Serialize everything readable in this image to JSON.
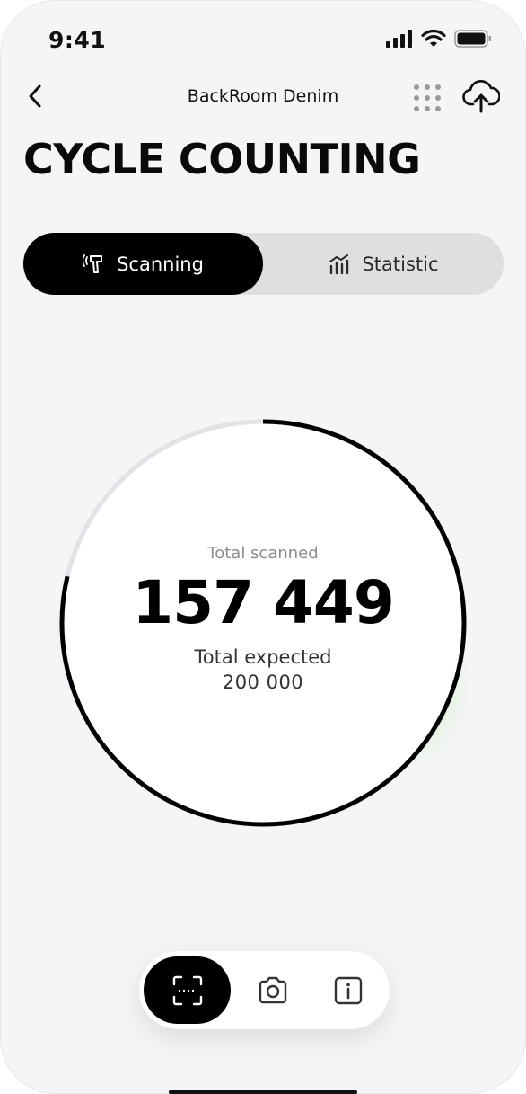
{
  "status_bar": {
    "time": "9:41"
  },
  "nav": {
    "title": "BackRoom Denim"
  },
  "page": {
    "title": "CYCLE COUNTING"
  },
  "tabs": [
    {
      "label": "Scanning",
      "icon": "scanner-gun-icon",
      "active": true
    },
    {
      "label": "Statistic",
      "icon": "bar-stats-icon",
      "active": false
    }
  ],
  "progress": {
    "scanned_label": "Total scanned",
    "scanned_value": "157 449",
    "expected_label": "Total expected",
    "expected_value": "200 000",
    "fraction": 0.787
  },
  "bottom_bar": {
    "items": [
      {
        "icon": "scan-frame-icon",
        "active": true
      },
      {
        "icon": "camera-icon",
        "active": false
      },
      {
        "icon": "info-icon",
        "active": false
      }
    ]
  },
  "colors": {
    "background": "#f4f5f7",
    "accent": "#000000",
    "track": "#e2e3e6"
  }
}
